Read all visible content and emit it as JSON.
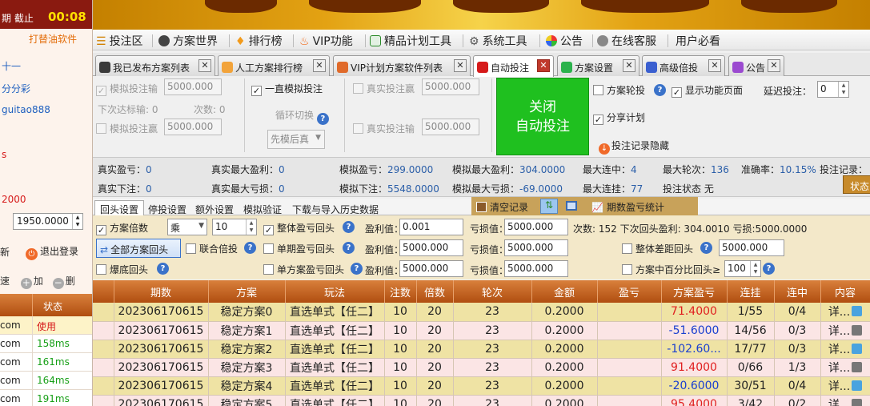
{
  "sidebar": {
    "top_left": "期 截止",
    "timer": "00:08",
    "brand": "打替油软件",
    "line1": "十一",
    "line2": "分分彩",
    "line3": "guitao888",
    "line4": "s",
    "line5": "2000",
    "money_value": "1950.0000",
    "new_label": "新",
    "logout_label": "退出登录",
    "speed_label": "速",
    "add_label": "加",
    "del_label": "删",
    "table_header_status": "状态",
    "rows": [
      {
        "a": "com",
        "b": "使用",
        "red": true
      },
      {
        "a": "com",
        "b": "158ms",
        "red": false
      },
      {
        "a": "com",
        "b": "161ms",
        "red": false
      },
      {
        "a": "com",
        "b": "164ms",
        "red": false
      },
      {
        "a": "com",
        "b": "191ms",
        "red": false
      }
    ]
  },
  "menu": {
    "items": [
      "投注区",
      "方案世界",
      "排行榜",
      "VIP功能",
      "精品计划工具",
      "系统工具",
      "公告",
      "在线客服",
      "用户必看"
    ]
  },
  "tabs": [
    {
      "label": "我已发布方案列表",
      "color": "#3a3a3a"
    },
    {
      "label": "人工方案排行榜",
      "color": "#f2a33a"
    },
    {
      "label": "VIP计划方案软件列表",
      "color": "#e06a2a"
    },
    {
      "label": "自动投注",
      "color": "#d61a1a"
    },
    {
      "label": "方案设置",
      "color": "#2bb24c"
    },
    {
      "label": "高级倍投",
      "color": "#3a5fd0"
    },
    {
      "label": "公告",
      "color": "#9b4ad0"
    }
  ],
  "controls": {
    "sim_profit": "模拟投注输",
    "sim_profit_val": "5000.000",
    "next_target": "下次达标输: 0",
    "times": "次数: 0",
    "sim_loss": "模拟投注赢",
    "sim_loss_val": "5000.000",
    "always_sim": "一直模拟投注",
    "loop_switch": "循环切换",
    "first_then_real": "先模后真",
    "real_profit": "真实投注赢",
    "real_profit_val": "5000.000",
    "real_loss": "真实投注输",
    "real_loss_val": "5000.000",
    "close_line1": "关闭",
    "close_line2": "自动投注",
    "plan_rotate": "方案轮投",
    "show_page": "显示功能页面",
    "delay_label": "延迟投注：",
    "delay_val": "0",
    "share_plan": "分享计划",
    "hide_record": "投注记录隐藏"
  },
  "stats": {
    "real_pl_label": "真实盈亏：",
    "real_pl": "0",
    "real_max_profit_label": "真实最大盈利：",
    "real_max_profit": "0",
    "sim_pl_label": "模拟盈亏：",
    "sim_pl": "299.0000",
    "sim_max_profit_label": "模拟最大盈利：",
    "sim_max_profit": "304.0000",
    "max_win_streak_label": "最大连中：",
    "max_win_streak": "4",
    "max_rounds_label": "最大轮次：",
    "max_rounds": "136",
    "accuracy_label": "准确率：",
    "accuracy": "10.15%",
    "bet_record_label": "投注记录：",
    "real_bet_label": "真实下注：",
    "real_bet": "0",
    "real_max_loss_label": "真实最大亏损：",
    "real_max_loss": "0",
    "sim_bet_label": "模拟下注：",
    "sim_bet": "5548.0000",
    "sim_max_loss_label": "模拟最大亏损：",
    "sim_max_loss": "-69.0000",
    "max_lose_streak_label": "最大连挂：",
    "max_lose_streak": "77",
    "bet_status_label": "投注状态",
    "bet_status": "无",
    "status_btn": "状态"
  },
  "subtabs": [
    "回头设置",
    "停投设置",
    "额外设置",
    "模拟验证",
    "下载与导入历史数据"
  ],
  "subtools": {
    "clear": "清空记录",
    "period_stats": "期数盈亏统计"
  },
  "filters": {
    "plan_multiple": "方案倍数",
    "multiply": "乘",
    "multiple_val": "10",
    "total_pl_back": "整体盈亏回头",
    "profit_val_label": "盈利值：",
    "profit_val1": "0.001",
    "loss_val_label": "亏损值：",
    "loss_val1": "5000.000",
    "summary": "次数: 152  下次回头盈利: 304.0010  亏损:5000.0000",
    "all_back": "全部方案回头",
    "joint_multi": "联合倍投",
    "single_pl_back": "单期盈亏回头",
    "profit_val2": "5000.000",
    "loss_val2": "5000.000",
    "total_diff_back": "整体差距回头",
    "diff_val": "5000.000",
    "bottom_back": "爆底回头",
    "plan_single_back": "单方案盈亏回头",
    "profit_val3": "5000.000",
    "loss_val3": "5000.000",
    "percent_back": "方案中百分比回头≥",
    "percent_val": "100"
  },
  "grid": {
    "headers": [
      "期数",
      "方案",
      "玩法",
      "注数",
      "倍数",
      "轮次",
      "金额",
      "盈亏",
      "方案盈亏",
      "连挂",
      "连中",
      "内容"
    ],
    "rows": [
      [
        "202306170615",
        "稳定方案0",
        "直选单式【任二】",
        "10",
        "20",
        "23",
        "0.2000",
        "",
        "71.4000",
        "1/55",
        "0/4",
        "详..."
      ],
      [
        "202306170615",
        "稳定方案1",
        "直选单式【任二】",
        "10",
        "20",
        "23",
        "0.2000",
        "",
        "-51.6000",
        "14/56",
        "0/3",
        "详..."
      ],
      [
        "202306170615",
        "稳定方案2",
        "直选单式【任二】",
        "10",
        "20",
        "23",
        "0.2000",
        "",
        "-102.60...",
        "17/77",
        "0/3",
        "详..."
      ],
      [
        "202306170615",
        "稳定方案3",
        "直选单式【任二】",
        "10",
        "20",
        "23",
        "0.2000",
        "",
        "91.4000",
        "0/66",
        "1/3",
        "详..."
      ],
      [
        "202306170615",
        "稳定方案4",
        "直选单式【任二】",
        "10",
        "20",
        "23",
        "0.2000",
        "",
        "-20.6000",
        "30/51",
        "0/4",
        "详..."
      ],
      [
        "202306170615",
        "稳定方案5",
        "直选单式【任二】",
        "10",
        "20",
        "23",
        "0.2000",
        "",
        "95.4000",
        "3/42",
        "0/2",
        "详..."
      ]
    ]
  }
}
